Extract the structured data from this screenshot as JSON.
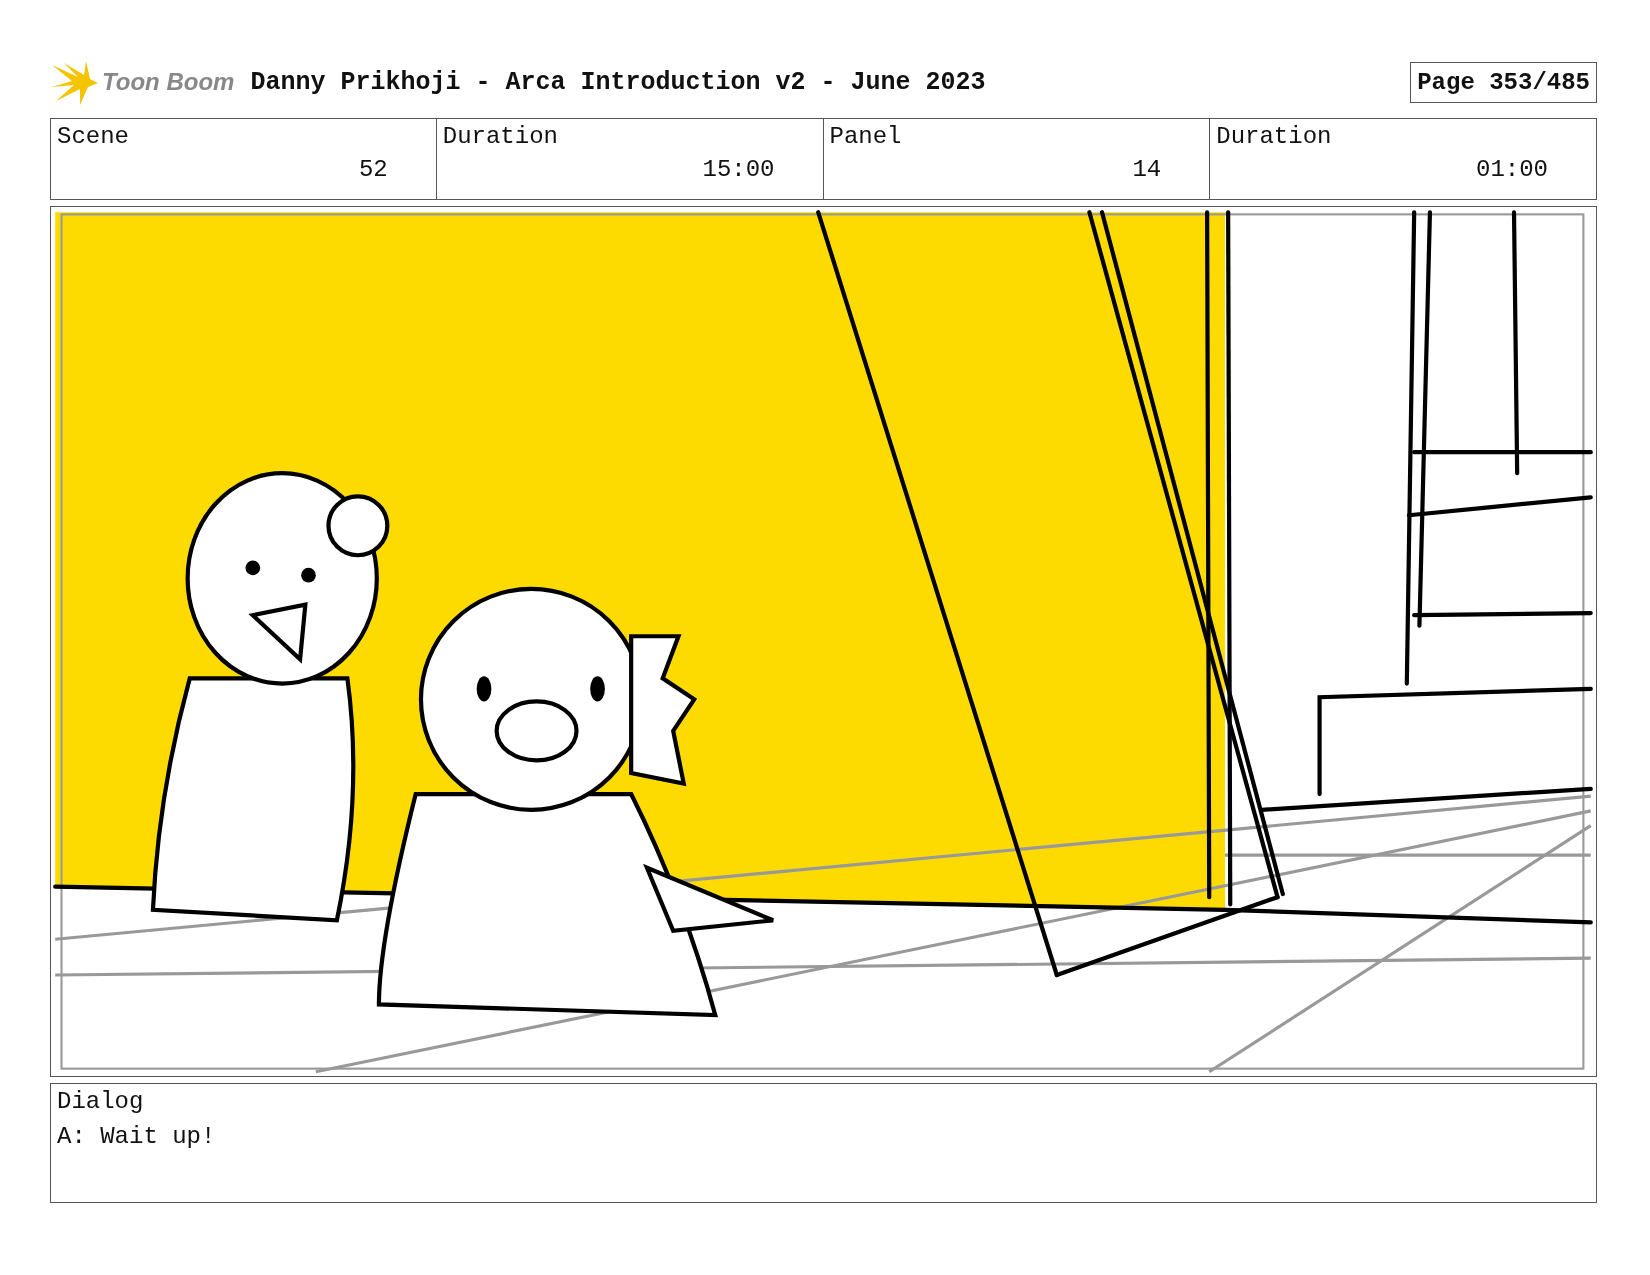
{
  "header": {
    "logo_text": "Toon Boom",
    "title": "Danny Prikhoji - Arca Introduction v2 - June 2023",
    "page": "Page 353/485"
  },
  "info": [
    {
      "label": "Scene",
      "value": "52"
    },
    {
      "label": "Duration",
      "value": "15:00"
    },
    {
      "label": "Panel",
      "value": "14"
    },
    {
      "label": "Duration",
      "value": "01:00"
    }
  ],
  "dialog": {
    "label": "Dialog",
    "text": "A: Wait up!"
  }
}
